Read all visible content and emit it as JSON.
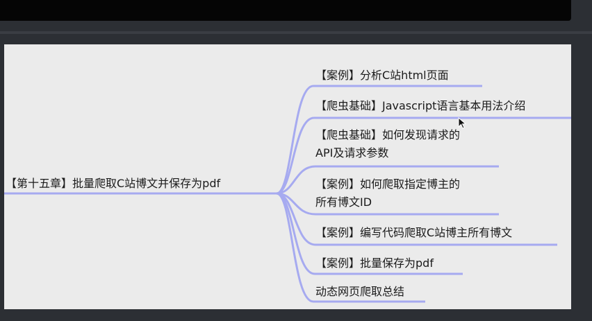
{
  "colors": {
    "background": "#2c2f34",
    "canvas": "#ebebeb",
    "branch": "#a6aaf0",
    "text": "#1a1a1a"
  },
  "mindmap": {
    "root": {
      "label": "【第十五章】批量爬取C站博文并保存为pdf"
    },
    "branches": [
      {
        "lines": [
          "【案例】分析C站html页面"
        ]
      },
      {
        "lines": [
          "【爬虫基础】Javascript语言基本用法介绍"
        ]
      },
      {
        "lines": [
          "【爬虫基础】如何发现请求的",
          "API及请求参数"
        ]
      },
      {
        "lines": [
          "【案例】如何爬取指定博主的",
          "所有博文ID"
        ]
      },
      {
        "lines": [
          "【案例】编写代码爬取C站博主所有博文"
        ]
      },
      {
        "lines": [
          "【案例】批量保存为pdf"
        ]
      },
      {
        "lines": [
          "动态网页爬取总结"
        ]
      }
    ]
  },
  "cursor": {
    "icon": "mouse-pointer-icon"
  }
}
